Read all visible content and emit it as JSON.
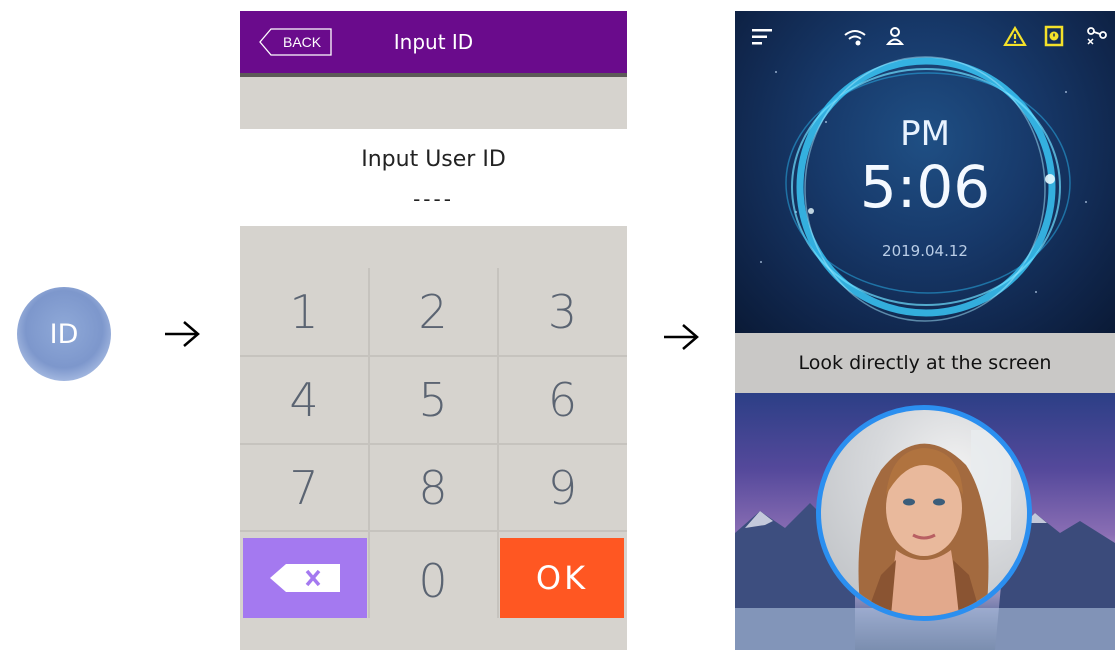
{
  "step1": {
    "icon_label": "ID"
  },
  "keypad_screen": {
    "back_label": "BACK",
    "title": "Input ID",
    "prompt": "Input User ID",
    "entry_value": "----",
    "keys": [
      "1",
      "2",
      "3",
      "4",
      "5",
      "6",
      "7",
      "8",
      "9",
      "0"
    ],
    "delete_icon": "backspace-icon",
    "ok_label": "OK",
    "colors": {
      "header": "#6a0b8c",
      "delete_key": "#a479f0",
      "ok_key": "#ff5722"
    }
  },
  "face_screen": {
    "status_icons": [
      "menu-icon",
      "wifi-icon",
      "user-icon",
      "warning-icon",
      "alert-icon",
      "network-disconnected-icon"
    ],
    "ampm": "PM",
    "time": "5:06",
    "date": "2019.04.12",
    "message": "Look directly at the screen",
    "colors": {
      "face_ring": "#2b8ff0",
      "message_bar": "#c9c8c6"
    }
  }
}
